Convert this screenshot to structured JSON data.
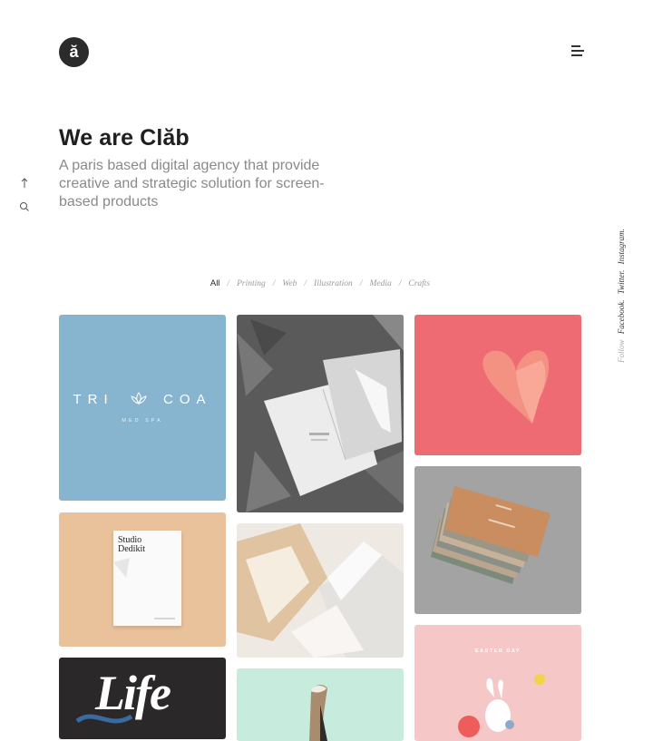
{
  "logo": {
    "glyph": "ă"
  },
  "hero": {
    "title": "We are Clăb",
    "subtitle": "A paris based digital agency that provide creative and strategic solution for screen-based products"
  },
  "filters": [
    {
      "label": "All",
      "active": true
    },
    {
      "label": "Printing"
    },
    {
      "label": "Web"
    },
    {
      "label": "Illustration"
    },
    {
      "label": "Media"
    },
    {
      "label": "Crafts"
    }
  ],
  "filter_separator": "/",
  "social": {
    "follow": "Follow",
    "links": [
      "Facebook.",
      "Twitter.",
      "Instagram."
    ]
  },
  "icons": {
    "menu": "menu-icon",
    "scroll_up": "arrow-up-icon",
    "search": "search-icon"
  },
  "portfolio": {
    "tricoa": {
      "word_left": "TRI",
      "word_right": "COA",
      "sub": "MED SPA"
    },
    "studio": {
      "line1": "Studio",
      "line2": "Dedikit"
    },
    "life": {
      "text": "Life"
    },
    "easter": {
      "text": "EASTER DAY"
    }
  },
  "colors": {
    "tile_blue": "#87b5cf",
    "tile_pink": "#ef6b74",
    "tile_peach": "#e9c19b",
    "tile_gray": "#9a9a9a",
    "tile_black": "#2a2828",
    "tile_mint": "#c7ebdc",
    "tile_blush": "#f6c7c7",
    "logo_bg": "#2b2b2b"
  }
}
